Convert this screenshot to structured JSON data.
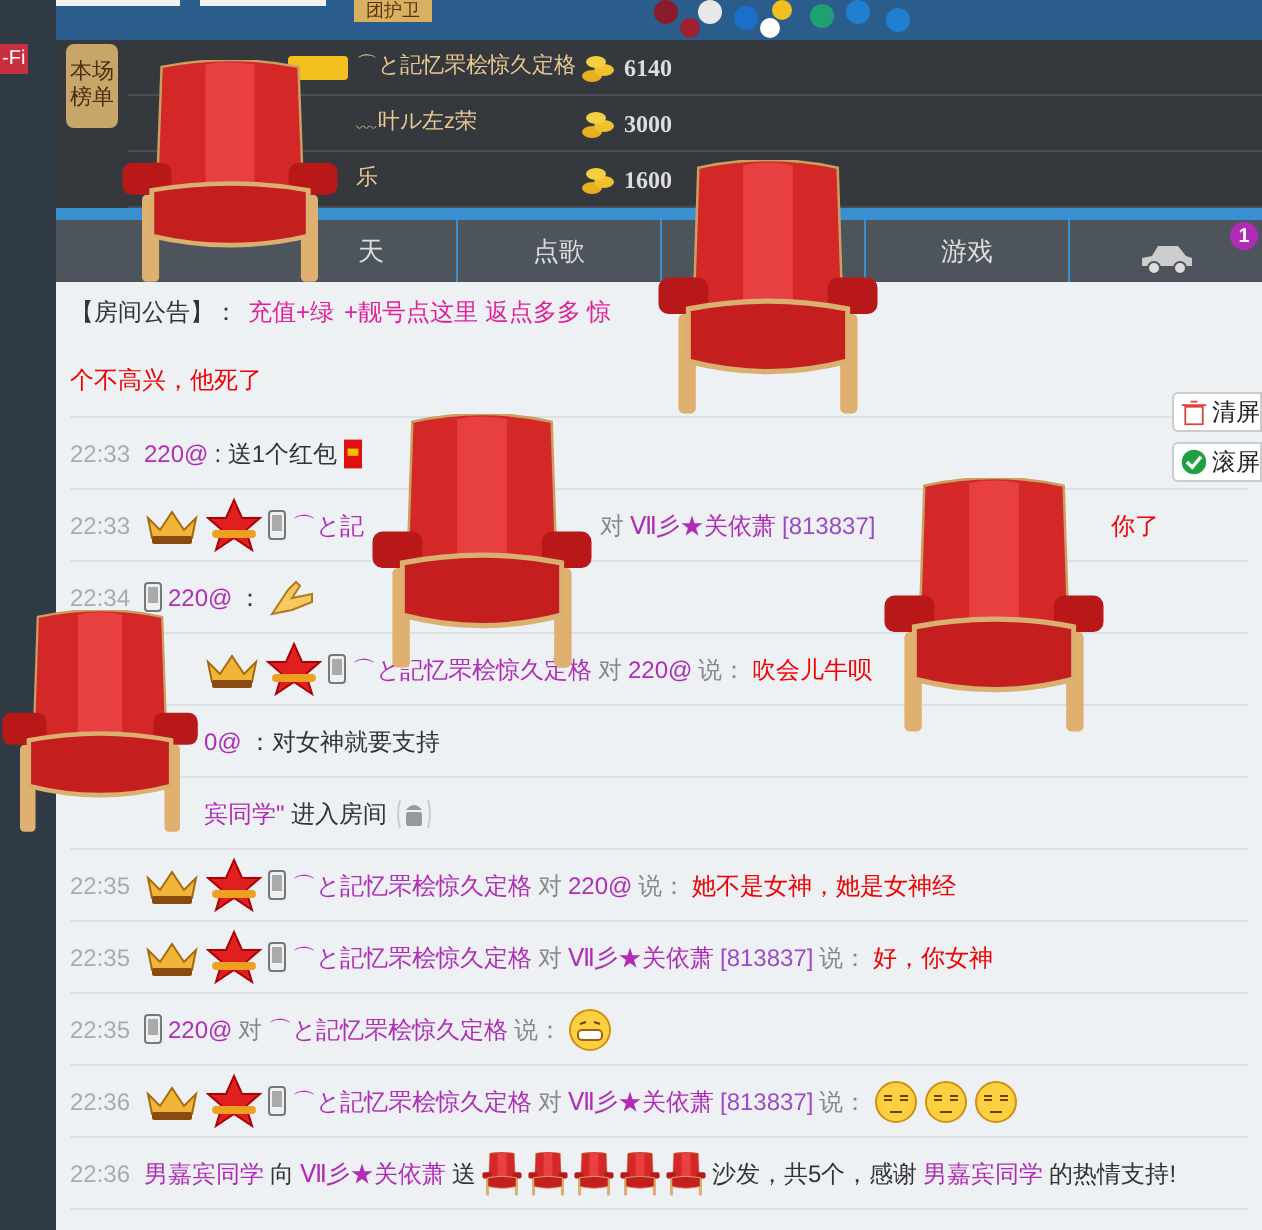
{
  "top_bar": {
    "badge": "团护卫"
  },
  "side_tag": "-Fi",
  "ranking": {
    "label": "本场榜单",
    "rows": [
      {
        "name": "⌒と記忆罘桧惊久定格",
        "coins": "6140",
        "vip": true
      },
      {
        "name": "﹏叶ル左z荣",
        "coins": "3000",
        "vip": false
      },
      {
        "name": "乐",
        "coins": "1600",
        "vip": false
      }
    ]
  },
  "tabs": [
    {
      "kind": "text",
      "label": "天"
    },
    {
      "kind": "text",
      "label": "点歌"
    },
    {
      "kind": "empty"
    },
    {
      "kind": "text",
      "label": "游戏"
    },
    {
      "kind": "car",
      "badge": "1"
    }
  ],
  "notice": {
    "label": "【房间公告】：",
    "parts": [
      "充值+绿",
      "+靓号点这里 返点多多 惊"
    ]
  },
  "side_buttons": [
    {
      "kind": "clear",
      "label": "清屏"
    },
    {
      "kind": "scroll",
      "label": "滚屏"
    }
  ],
  "messages": [
    {
      "segments": [
        {
          "kind": "red",
          "text": "个不高兴，他死了"
        }
      ]
    },
    {
      "time": "22:33",
      "segments": [
        {
          "kind": "name",
          "text": "220@"
        },
        {
          "kind": "plain",
          "text": ": 送1个红包"
        },
        {
          "kind": "envelope"
        }
      ]
    },
    {
      "time": "22:33",
      "segments": [
        {
          "kind": "crown"
        },
        {
          "kind": "star"
        },
        {
          "kind": "phone"
        },
        {
          "kind": "name",
          "text": "⌒と記"
        },
        {
          "kind": "chair_gap"
        },
        {
          "kind": "gray",
          "text": "对"
        },
        {
          "kind": "name",
          "text": "Ⅶ彡★关依萧"
        },
        {
          "kind": "id",
          "text": "[813837]"
        },
        {
          "kind": "chair_gap"
        },
        {
          "kind": "red",
          "text": "你了"
        }
      ]
    },
    {
      "time": "22:34",
      "segments": [
        {
          "kind": "phone"
        },
        {
          "kind": "name",
          "text": "220@"
        },
        {
          "kind": "plain",
          "text": "："
        },
        {
          "kind": "hand"
        }
      ]
    },
    {
      "segments": [
        {
          "kind": "indent"
        },
        {
          "kind": "crown"
        },
        {
          "kind": "star"
        },
        {
          "kind": "phone"
        },
        {
          "kind": "name",
          "text": "⌒と記忆罘桧惊久定格"
        },
        {
          "kind": "gray",
          "text": "对"
        },
        {
          "kind": "name",
          "text": "220@"
        },
        {
          "kind": "gray",
          "text": "说："
        },
        {
          "kind": "red",
          "text": "吹会儿牛呗"
        }
      ]
    },
    {
      "segments": [
        {
          "kind": "indent"
        },
        {
          "kind": "name",
          "text": "0@"
        },
        {
          "kind": "plain",
          "text": "：对女神就要支持"
        }
      ]
    },
    {
      "segments": [
        {
          "kind": "indent"
        },
        {
          "kind": "name",
          "text": "宾同学\""
        },
        {
          "kind": "plain",
          "text": "进入房间"
        },
        {
          "kind": "android"
        }
      ]
    },
    {
      "time": "22:35",
      "segments": [
        {
          "kind": "crown"
        },
        {
          "kind": "star"
        },
        {
          "kind": "phone"
        },
        {
          "kind": "name",
          "text": "⌒と記忆罘桧惊久定格"
        },
        {
          "kind": "gray",
          "text": "对"
        },
        {
          "kind": "name",
          "text": "220@"
        },
        {
          "kind": "gray",
          "text": "说："
        },
        {
          "kind": "red",
          "text": "她不是女神，她是女神经"
        }
      ]
    },
    {
      "time": "22:35",
      "segments": [
        {
          "kind": "crown"
        },
        {
          "kind": "star"
        },
        {
          "kind": "phone"
        },
        {
          "kind": "name",
          "text": "⌒と記忆罘桧惊久定格"
        },
        {
          "kind": "gray",
          "text": "对"
        },
        {
          "kind": "name",
          "text": "Ⅶ彡★关依萧"
        },
        {
          "kind": "id",
          "text": "[813837]"
        },
        {
          "kind": "gray",
          "text": "说："
        },
        {
          "kind": "red",
          "text": "好，你女神"
        }
      ]
    },
    {
      "time": "22:35",
      "segments": [
        {
          "kind": "phone"
        },
        {
          "kind": "name",
          "text": "220@"
        },
        {
          "kind": "gray",
          "text": "对"
        },
        {
          "kind": "name",
          "text": "⌒と記忆罘桧惊久定格"
        },
        {
          "kind": "gray",
          "text": "说："
        },
        {
          "kind": "grin"
        }
      ]
    },
    {
      "time": "22:36",
      "segments": [
        {
          "kind": "crown"
        },
        {
          "kind": "star"
        },
        {
          "kind": "phone"
        },
        {
          "kind": "name",
          "text": "⌒と記忆罘桧惊久定格"
        },
        {
          "kind": "gray",
          "text": "对"
        },
        {
          "kind": "name",
          "text": "Ⅶ彡★关依萧"
        },
        {
          "kind": "id",
          "text": "[813837]"
        },
        {
          "kind": "gray",
          "text": "说："
        },
        {
          "kind": "smug"
        },
        {
          "kind": "smug"
        },
        {
          "kind": "smug"
        }
      ]
    },
    {
      "time": "22:36",
      "segments": [
        {
          "kind": "name",
          "text": "男嘉宾同学"
        },
        {
          "kind": "plain",
          "text": "向"
        },
        {
          "kind": "name",
          "text": "Ⅶ彡★关依萧"
        },
        {
          "kind": "plain",
          "text": "送"
        },
        {
          "kind": "sofa"
        },
        {
          "kind": "sofa"
        },
        {
          "kind": "sofa"
        },
        {
          "kind": "sofa"
        },
        {
          "kind": "sofa"
        },
        {
          "kind": "plain",
          "text": "沙发，共5个，感谢"
        },
        {
          "kind": "name",
          "text": "男嘉宾同学"
        },
        {
          "kind": "plain",
          "text": "的热情支持!"
        }
      ]
    }
  ]
}
